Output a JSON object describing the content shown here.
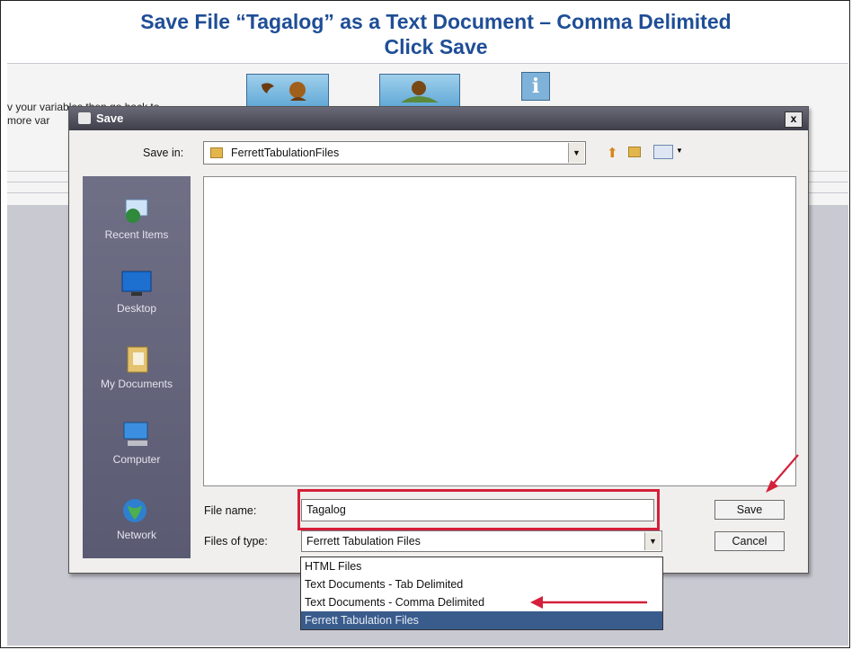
{
  "slide": {
    "title_line1": "Save File “Tagalog” as a Text Document – Comma Delimited",
    "title_line2": "Click Save"
  },
  "background_app": {
    "text_line1": "v your variables then go back to",
    "text_line2": "more var"
  },
  "dialog": {
    "title": "Save",
    "close_glyph": "x",
    "save_in_label": "Save in:",
    "save_in_value": "FerrettTabulationFiles",
    "places": [
      {
        "label": "Recent Items",
        "icon": "recent-items-icon"
      },
      {
        "label": "Desktop",
        "icon": "desktop-icon"
      },
      {
        "label": "My Documents",
        "icon": "my-documents-icon"
      },
      {
        "label": "Computer",
        "icon": "computer-icon"
      },
      {
        "label": "Network",
        "icon": "network-icon"
      }
    ],
    "file_name_label": "File name:",
    "file_name_value": "Tagalog",
    "files_of_type_label": "Files of type:",
    "files_of_type_value": "Ferrett Tabulation Files",
    "type_options": [
      "HTML Files",
      "Text Documents - Tab Delimited",
      "Text Documents - Comma Delimited",
      "Ferrett Tabulation Files"
    ],
    "selected_option_index": 3,
    "save_button": "Save",
    "cancel_button": "Cancel"
  },
  "annotation_color": "#d4203a",
  "title_color": "#1f4e96"
}
